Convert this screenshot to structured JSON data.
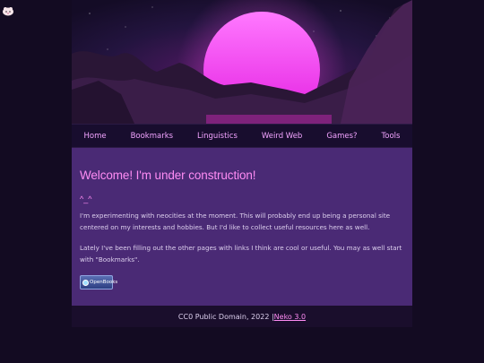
{
  "nav": {
    "items": [
      {
        "label": "Home"
      },
      {
        "label": "Bookmarks"
      },
      {
        "label": "Linguistics"
      },
      {
        "label": "Weird Web"
      },
      {
        "label": "Games?"
      },
      {
        "label": "Tools"
      }
    ]
  },
  "main": {
    "heading": "Welcome! I'm under construction!",
    "face": "^_^",
    "paragraph1": "I'm experimenting with neocities at the moment. This will probably end up being a personal site centered on my interests and hobbies. But I'd like to collect useful resources here as well.",
    "paragraph2": "Lately I've been filling out the other pages with links I think are cool or useful. You may as well start with \"Bookmarks\".",
    "badge_text": "OpenBooks"
  },
  "footer": {
    "text": "CC0 Public Domain, 2022 | ",
    "link": "Neko 3.0"
  },
  "colors": {
    "background": "#130b22",
    "nav_link": "#f2a4ff",
    "heading": "#ff8cf4",
    "main_bg": "#4a2a75",
    "sun": "#ff3df2"
  },
  "icons": {
    "corner": "pet-icon",
    "badge": "openbooks-logo-icon"
  }
}
